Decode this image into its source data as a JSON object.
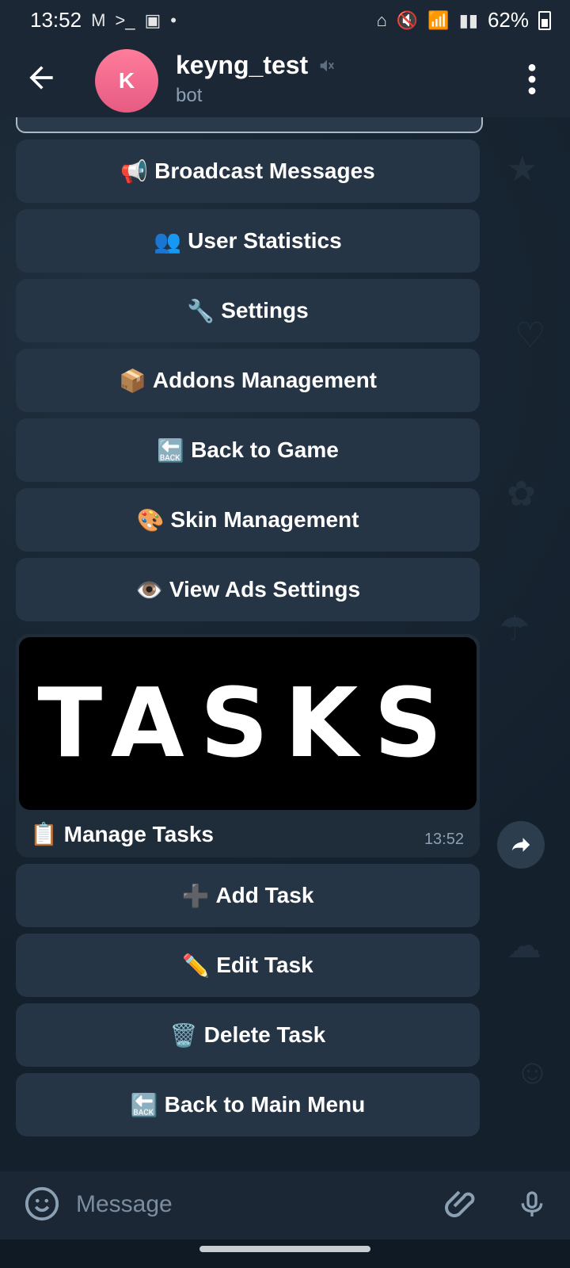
{
  "status_bar": {
    "time": "13:52",
    "icons_left": [
      "gmail-icon",
      "terminal-icon",
      "image-icon",
      "dot-icon"
    ],
    "battery": "62%"
  },
  "header": {
    "avatar_letter": "K",
    "title": "keyng_test",
    "subtitle": "bot"
  },
  "menu_buttons_top": [
    {
      "emoji": "📢",
      "label": "Broadcast Messages"
    },
    {
      "emoji": "👥",
      "label": "User Statistics"
    },
    {
      "emoji": "🔧",
      "label": "Settings"
    },
    {
      "emoji": "📦",
      "label": "Addons Management"
    },
    {
      "emoji": "🔙",
      "label": "Back to Game"
    },
    {
      "emoji": "🎨",
      "label": "Skin Management"
    },
    {
      "emoji": "👁️",
      "label": "View Ads Settings"
    }
  ],
  "tasks_card": {
    "image_text": "TASKS",
    "caption_emoji": "📋",
    "caption": "Manage Tasks",
    "time": "13:52"
  },
  "menu_buttons_bottom": [
    {
      "emoji": "➕",
      "label": "Add Task"
    },
    {
      "emoji": "✏️",
      "label": "Edit Task"
    },
    {
      "emoji": "🗑️",
      "label": "Delete Task"
    },
    {
      "emoji": "🔙",
      "label": "Back to Main Menu"
    }
  ],
  "input": {
    "placeholder": "Message"
  },
  "colors": {
    "header_bg": "#1b2735",
    "button_bg": "#263546",
    "avatar": "#ff7c9b",
    "muted_text": "#8ca0b4"
  }
}
